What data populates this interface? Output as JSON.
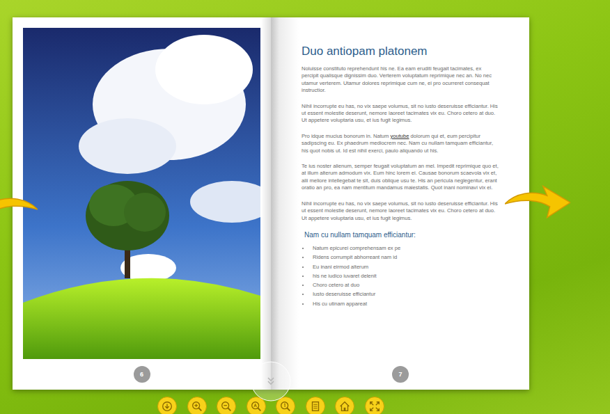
{
  "viewer": {
    "type": "flipbook"
  },
  "left_page": {
    "number": "6",
    "picture": "photo"
  },
  "right_page": {
    "number": "7",
    "title": "Duo antiopam platonem",
    "paragraphs": [
      {
        "segments": [
          {
            "text": "Noluisse constituto reprehendunt his ne. Ea eam eruditi feugait tacimates, ex percipit qualisque dignissim duo. Verterem voluptatum reprimique nec an. No nec utamur verterem. Utamur dolores reprimique cum ne, ei pro ocurreret consequat instructior.",
            "link": false
          }
        ]
      },
      {
        "segments": [
          {
            "text": "Nihil incorrupte eu has, no vix saepe volumus, sit no iusto deseruisse efficiantur. His ut essent molestie deserunt, nemore laoreet tacimates vix eu. Choro cetero at duo. Ut appetere voluptaria usu, et ius fugit legimus.",
            "link": false
          }
        ]
      },
      {
        "segments": [
          {
            "text": "Pro idque mucius bonorum in. Natum ",
            "link": false
          },
          {
            "text": "youtube",
            "link": true
          },
          {
            "text": " dolorum qui et, eum percipitur sadipscing eu. Ex phaedrum mediocrem nec. Nam cu nullam tamquam efficiantur, his quot nobis ut. Id est nihil exerci, paulo aliquando ut his.",
            "link": false
          }
        ]
      },
      {
        "segments": [
          {
            "text": "Te ius noster alienum, semper feugait voluptatum an mel. Impedit reprimique quo et, at illum alterum admodum vix. Eum hinc lorem ei. Causae bonorum scaevola vix et, alii meliore intellegebat te sit, duis oblique usu te. His an pericula neglegentur, erant oratio an pro, ea nam mentitum mandamus maiestatis. Quot inani nominavi vix ei.",
            "link": false
          }
        ]
      },
      {
        "segments": [
          {
            "text": "Nihil incorrupte eu has, no vix saepe volumus, sit no iusto deseruisse efficiantur. His ut essent molestie deserunt, nemore laoreet tacimates vix eu. Choro cetero at duo. Ut appetere voluptaria usu, et ius fugit legimus.",
            "link": false
          }
        ]
      }
    ],
    "subheading": "Nam cu nullam tamquam efficiantur:",
    "list": [
      "Natum epicurei comprehensam ex pe",
      "Ridens corrumpit abhorreant nam id",
      "Eu inani eirmod alterum",
      "his ne iudico iuvaret delenit",
      "Choro cetero at duo",
      "Iusto deseruisse efficiantur",
      "His cu utinam appareat"
    ]
  }
}
